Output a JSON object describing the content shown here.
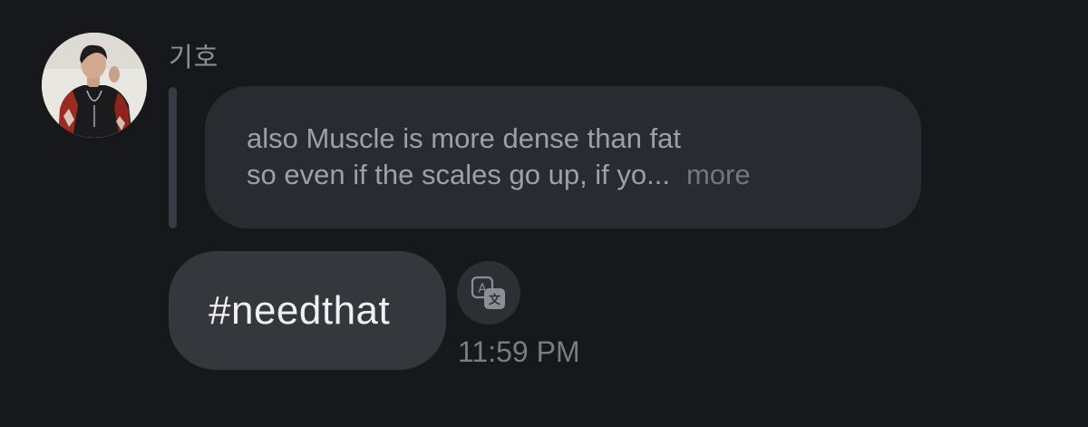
{
  "sender": {
    "name": "기호",
    "avatar_icon": "profile-photo-avatar"
  },
  "reply": {
    "quoted_lines": [
      "also Muscle is more dense than fat",
      "so even if the scales go up, if yo..."
    ],
    "more_label": "more"
  },
  "message": {
    "text": "#needthat",
    "timestamp": "11:59 PM",
    "translate_icon": "translate-icon"
  },
  "colors": {
    "background": "#17181c",
    "quoted_bubble": "#2a2b30",
    "message_bubble": "#36373d",
    "muted_text": "#8e8f95"
  }
}
